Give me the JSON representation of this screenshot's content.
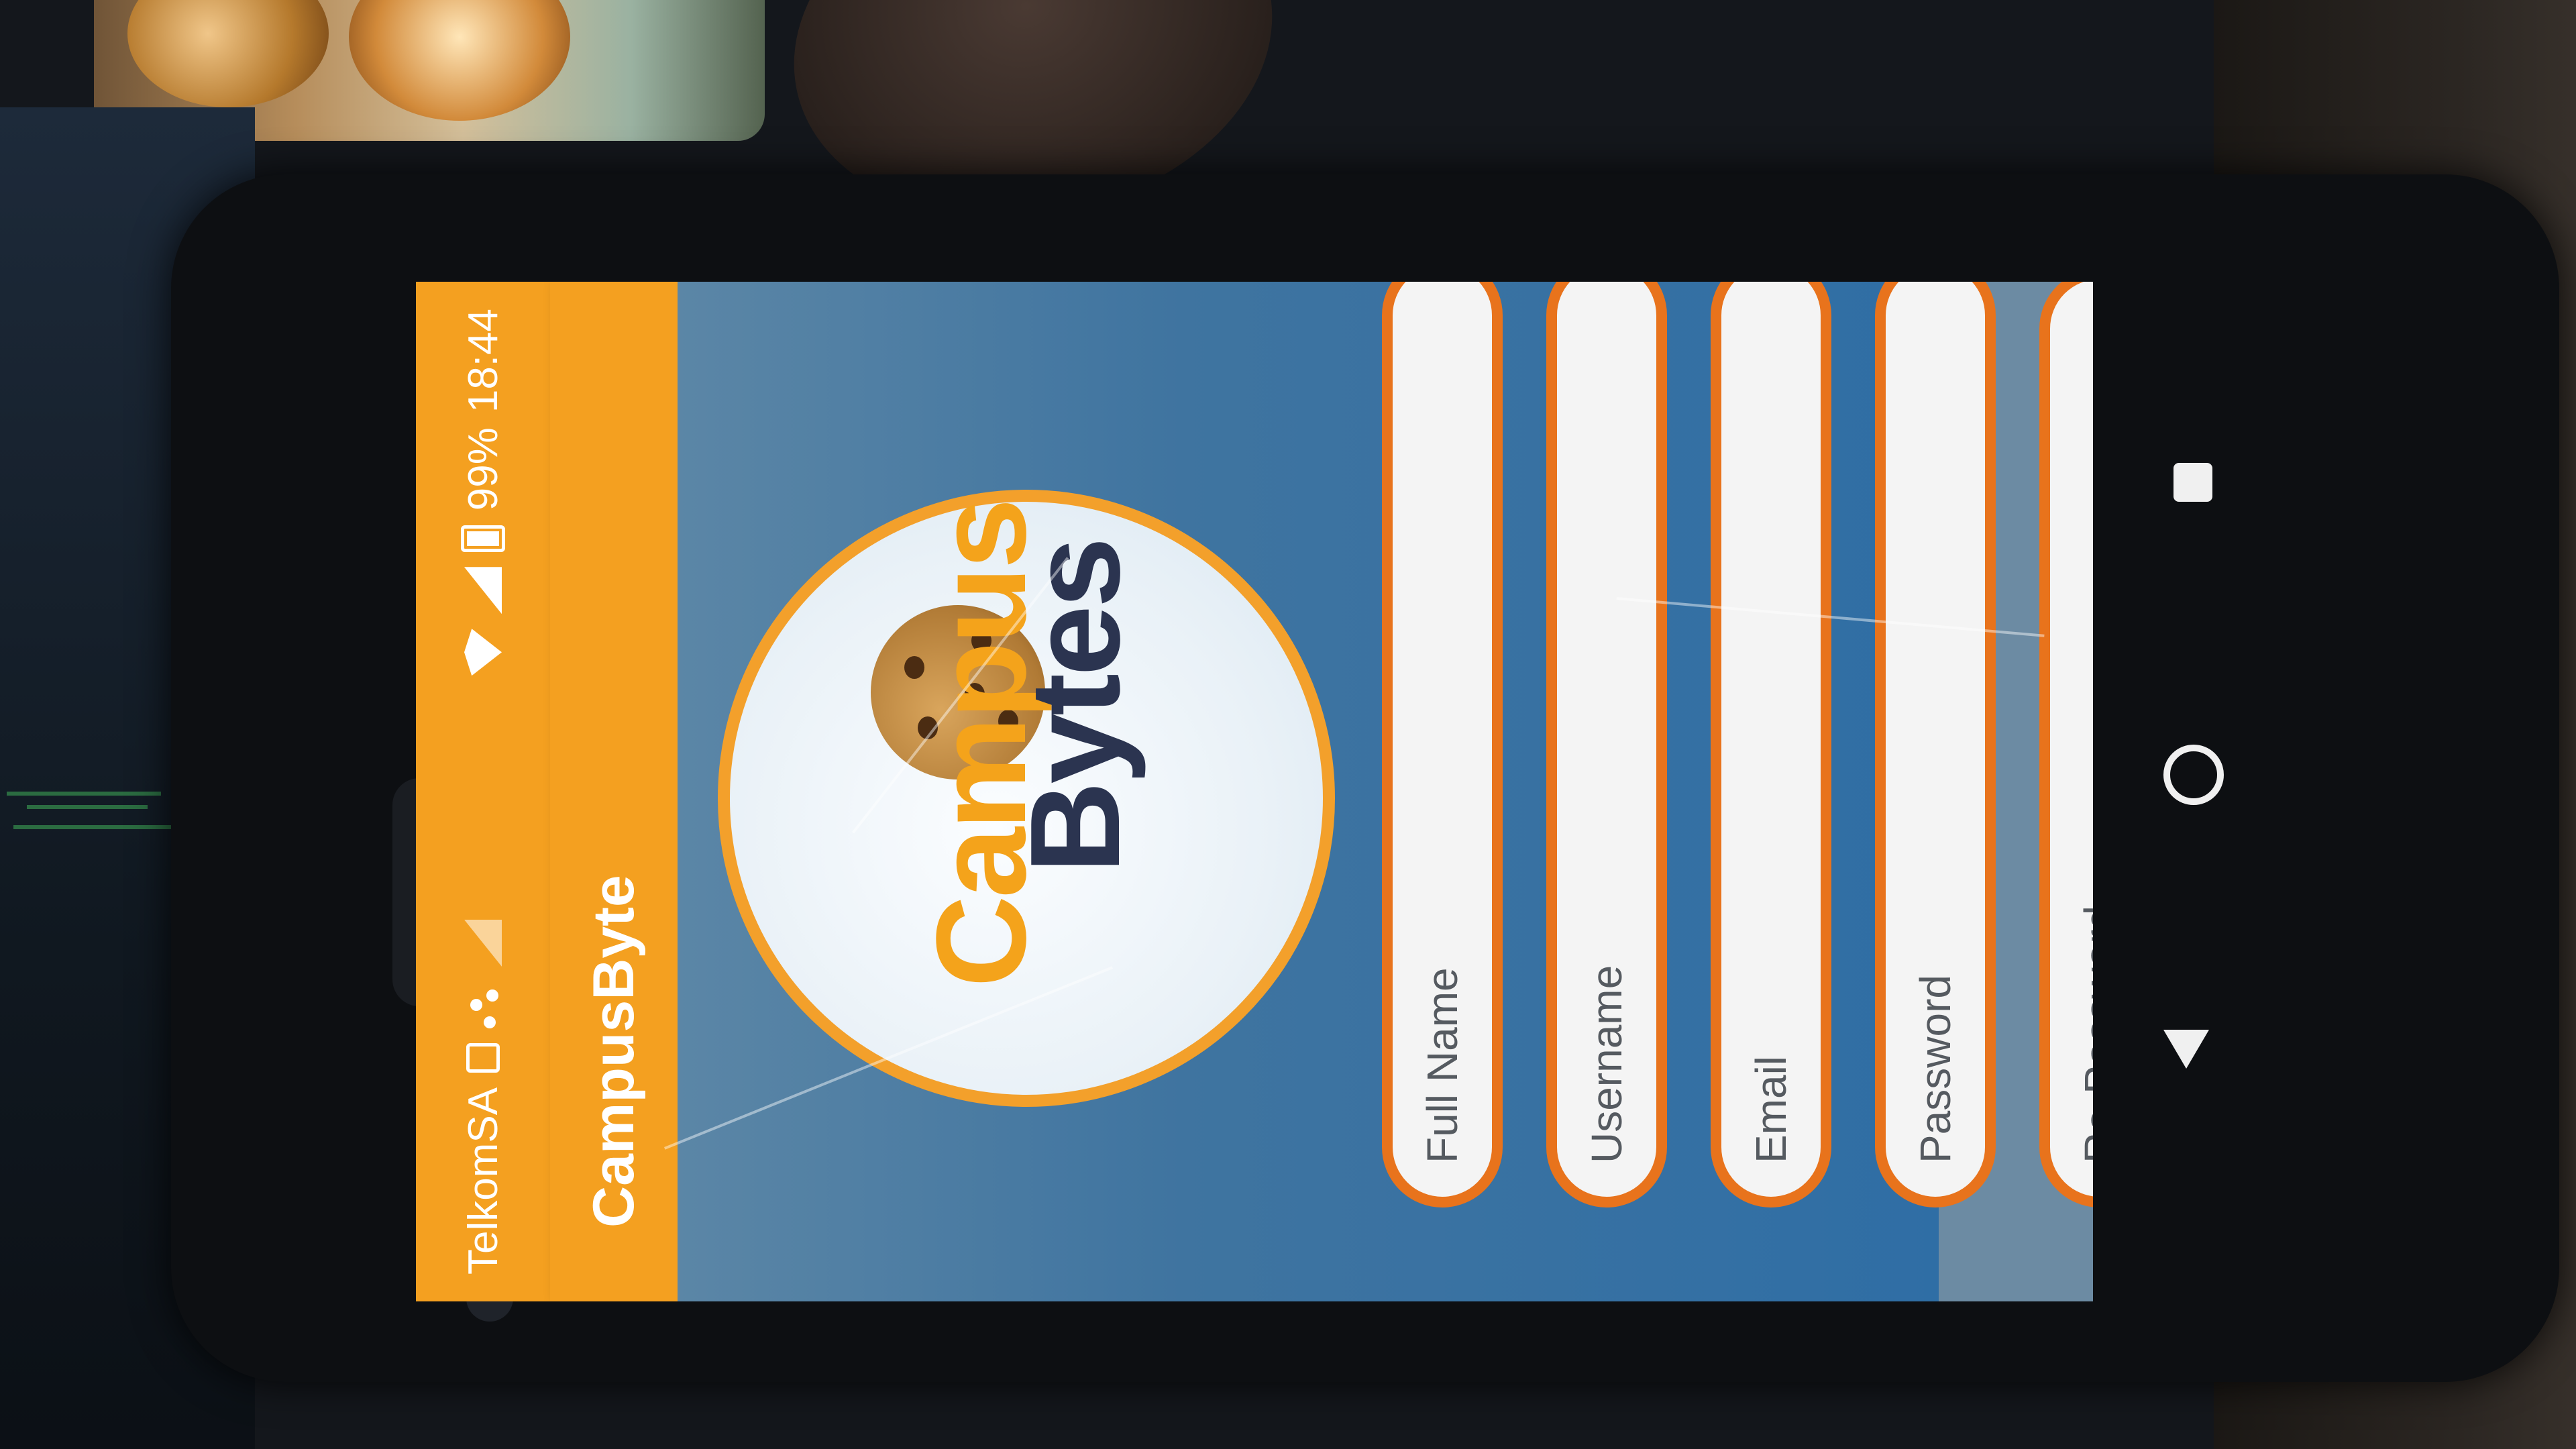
{
  "status_bar": {
    "carrier": "TelkomSA",
    "battery": "99%",
    "time": "18:44"
  },
  "app_bar": {
    "title": "CampusByte"
  },
  "logo": {
    "line1": "Campus",
    "line2": "Bytes"
  },
  "form": {
    "fields": [
      {
        "placeholder": "Full Name"
      },
      {
        "placeholder": "Username"
      },
      {
        "placeholder": "Email"
      },
      {
        "placeholder": "Password"
      },
      {
        "placeholder": "Re-Password"
      }
    ]
  },
  "colors": {
    "accent": "#f4a020",
    "field_border": "#e8731c",
    "logo_text_primary": "#f4a31b",
    "logo_text_secondary": "#2b3450"
  },
  "icons": [
    "box-icon",
    "dots-icon",
    "signal-off-icon",
    "wifi-icon",
    "signal-icon",
    "battery-icon",
    "nav-back-icon",
    "nav-home-icon",
    "nav-recent-icon"
  ]
}
